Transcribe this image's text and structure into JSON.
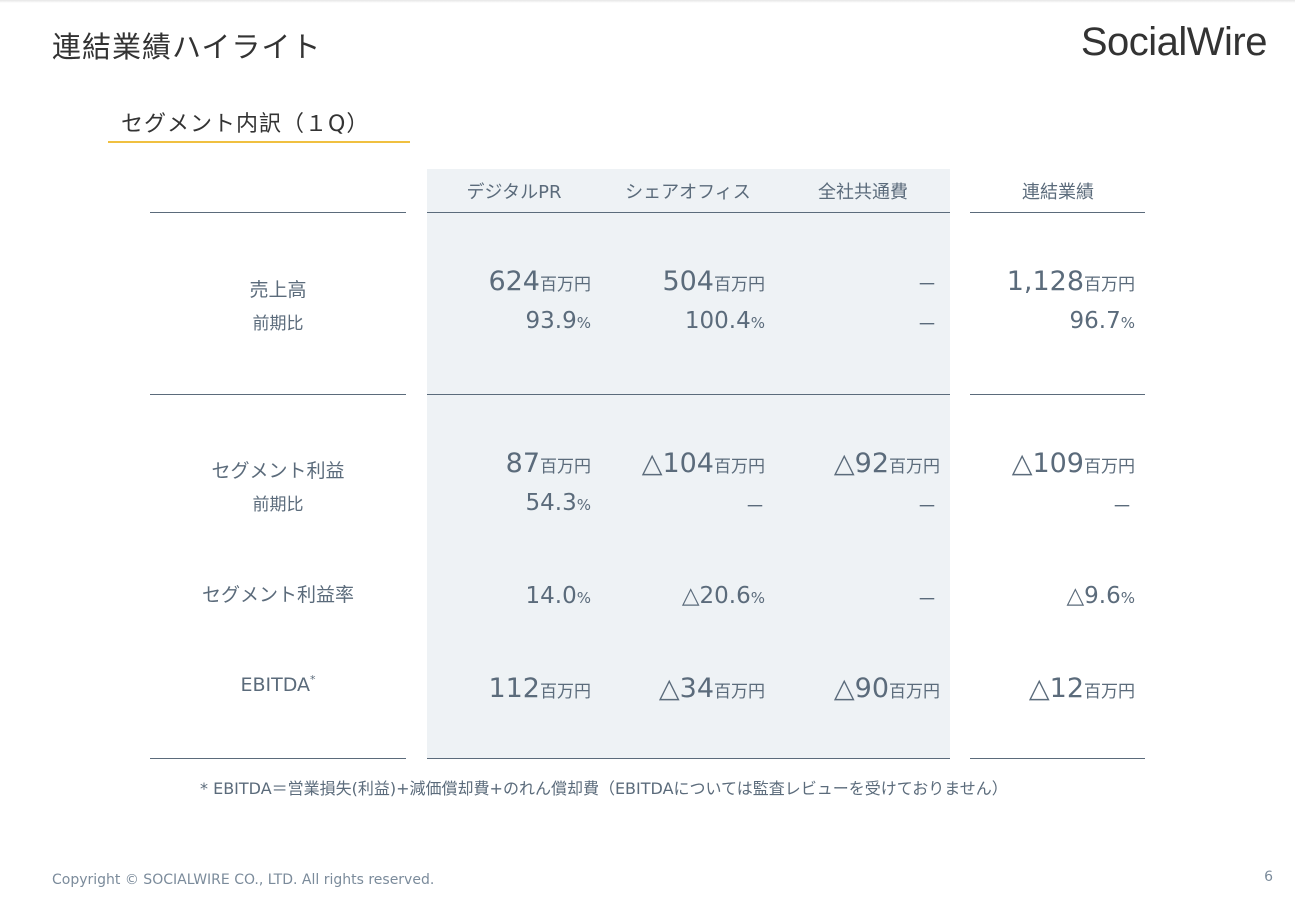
{
  "header": {
    "title": "連結業績ハイライト",
    "logo_text": "SocialWire"
  },
  "subtitle": "セグメント内訳（１Q）",
  "table": {
    "columns": [
      "デジタルPR",
      "シェアオフィス",
      "全社共通費",
      "連結業績"
    ],
    "rows": {
      "sales": {
        "label": "売上高",
        "sublabel": "前期比",
        "values": [
          {
            "amount": "624",
            "unit": "百万円",
            "ratio": "93.9",
            "ratio_unit": "%"
          },
          {
            "amount": "504",
            "unit": "百万円",
            "ratio": "100.4",
            "ratio_unit": "%"
          },
          {
            "amount": "－",
            "unit": "",
            "ratio": "－",
            "ratio_unit": ""
          },
          {
            "amount": "1,128",
            "unit": "百万円",
            "ratio": "96.7",
            "ratio_unit": "%"
          }
        ]
      },
      "segment_profit": {
        "label": "セグメント利益",
        "sublabel": "前期比",
        "values": [
          {
            "amount": "87",
            "unit": "百万円",
            "ratio": "54.3",
            "ratio_unit": "%"
          },
          {
            "amount": "△104",
            "unit": "百万円",
            "ratio": "－",
            "ratio_unit": ""
          },
          {
            "amount": "△92",
            "unit": "百万円",
            "ratio": "－",
            "ratio_unit": ""
          },
          {
            "amount": "△109",
            "unit": "百万円",
            "ratio": "－",
            "ratio_unit": ""
          }
        ]
      },
      "profit_margin": {
        "label": "セグメント利益率",
        "values": [
          {
            "amount": "14.0",
            "unit": "%"
          },
          {
            "amount": "△20.6",
            "unit": "%"
          },
          {
            "amount": "－",
            "unit": ""
          },
          {
            "amount": "△9.6",
            "unit": "%"
          }
        ]
      },
      "ebitda": {
        "label": "EBITDA",
        "label_mark": "*",
        "values": [
          {
            "amount": "112",
            "unit": "百万円"
          },
          {
            "amount": "△34",
            "unit": "百万円"
          },
          {
            "amount": "△90",
            "unit": "百万円"
          },
          {
            "amount": "△12",
            "unit": "百万円"
          }
        ]
      }
    }
  },
  "footnote": "* EBITDA＝営業損失(利益)+減価償却費+のれん償却費（EBITDAについては監査レビューを受けておりません）",
  "footer": {
    "copyright": "Copyright © SOCIALWIRE CO., LTD. All rights reserved.",
    "page_number": "6"
  },
  "colors": {
    "accent_underline": "#f0c040",
    "shade": "#eef2f5",
    "text": "#5b6b7b"
  }
}
